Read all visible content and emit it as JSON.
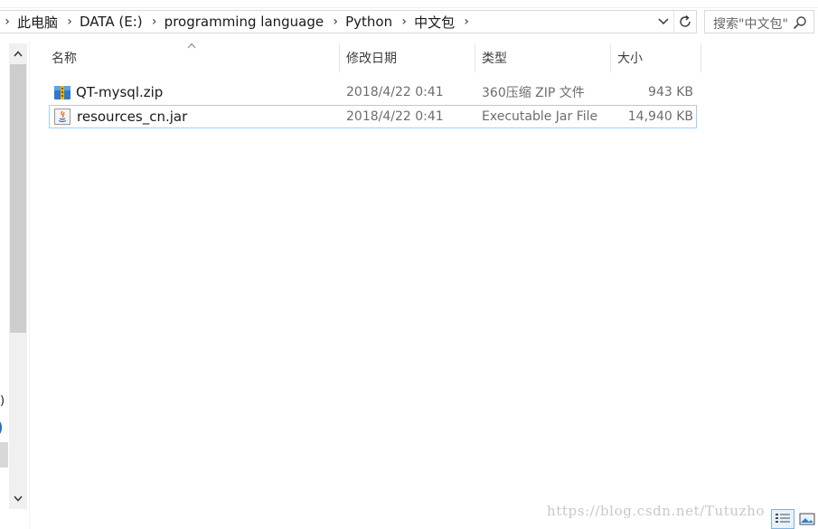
{
  "breadcrumb": {
    "items": [
      "此电脑",
      "DATA (E:)",
      "programming language",
      "Python",
      "中文包"
    ]
  },
  "search": {
    "placeholder": "搜索\"中文包\""
  },
  "columns": {
    "name": "名称",
    "date": "修改日期",
    "type": "类型",
    "size": "大小"
  },
  "files": [
    {
      "name": "QT-mysql.zip",
      "date": "2018/4/22 0:41",
      "type": "360压缩 ZIP 文件",
      "size": "943 KB",
      "icon": "zip-archive-icon"
    },
    {
      "name": "resources_cn.jar",
      "date": "2018/4/22 0:41",
      "type": "Executable Jar File",
      "size": "14,940 KB",
      "icon": "java-jar-icon"
    }
  ],
  "nav_partial_text": ")",
  "watermark": "https://blog.csdn.net/Tutuzho",
  "colors": {
    "selection_border": "#99d1ff",
    "secondary_text": "#6d6d6d",
    "accent": "#1e73c8"
  }
}
